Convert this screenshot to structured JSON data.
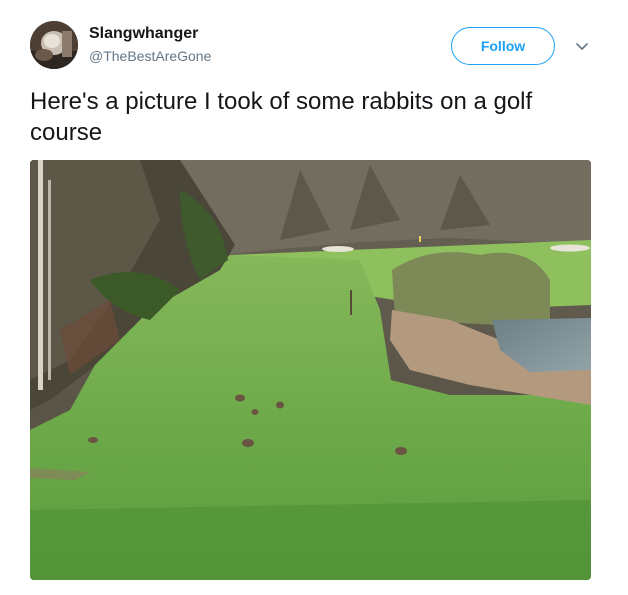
{
  "tweet": {
    "display_name": "Slangwhanger",
    "handle": "@TheBestAreGone",
    "follow_label": "Follow",
    "text": "Here's a picture I took of some rabbits on a golf course",
    "more_icon": "chevron-down-icon",
    "photo_subject": "rabbits on a golf course fairway"
  },
  "colors": {
    "accent": "#1da1f2",
    "name_text": "#14171a",
    "secondary_text": "#657786"
  }
}
